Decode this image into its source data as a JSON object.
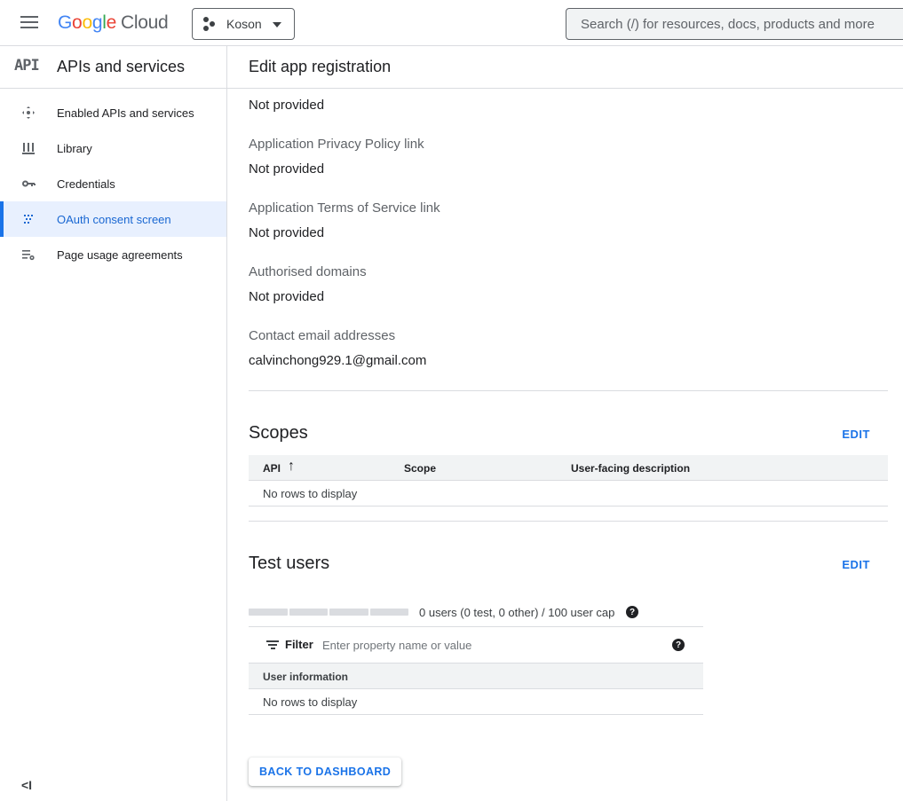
{
  "header": {
    "logo_google": [
      "G",
      "o",
      "o",
      "g",
      "l",
      "e"
    ],
    "logo_cloud": "Cloud",
    "project_name": "Koson",
    "search_placeholder": "Search (/) for resources, docs, products and more"
  },
  "sidebar": {
    "badge": "API",
    "title": "APIs and services",
    "items": [
      {
        "label": "Enabled APIs and services",
        "icon": "enabled-apis-icon",
        "active": false
      },
      {
        "label": "Library",
        "icon": "library-icon",
        "active": false
      },
      {
        "label": "Credentials",
        "icon": "key-icon",
        "active": false
      },
      {
        "label": "OAuth consent screen",
        "icon": "oauth-icon",
        "active": true
      },
      {
        "label": "Page usage agreements",
        "icon": "settings-list-icon",
        "active": false
      }
    ],
    "collapse_glyph": "<I"
  },
  "main": {
    "title": "Edit app registration",
    "fields": [
      {
        "label": "",
        "value": "Not provided"
      },
      {
        "label": "Application Privacy Policy link",
        "value": "Not provided"
      },
      {
        "label": "Application Terms of Service link",
        "value": "Not provided"
      },
      {
        "label": "Authorised domains",
        "value": "Not provided"
      },
      {
        "label": "Contact email addresses",
        "value": "calvinchong929.1@gmail.com"
      }
    ],
    "scopes": {
      "title": "Scopes",
      "edit_label": "EDIT",
      "columns": [
        "API",
        "Scope",
        "User-facing description"
      ],
      "sort_arrow": "↑",
      "empty_text": "No rows to display"
    },
    "test_users": {
      "title": "Test users",
      "edit_label": "EDIT",
      "cap_text": "0 users (0 test, 0 other) / 100 user cap",
      "filter_label": "Filter",
      "filter_placeholder": "Enter property name or value",
      "column": "User information",
      "empty_text": "No rows to display"
    },
    "back_button": "BACK TO DASHBOARD"
  },
  "colors": {
    "accent": "#1a73e8",
    "active_bg": "#e8f0fe"
  }
}
